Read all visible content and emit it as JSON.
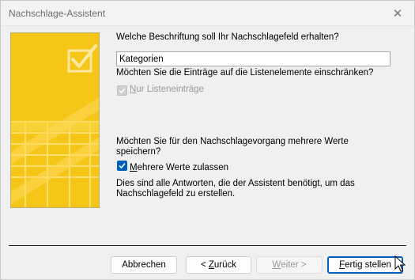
{
  "window": {
    "title": "Nachschlage-Assistent",
    "close_glyph": "✕"
  },
  "question": {
    "caption_prompt": "Welche Beschriftung soll Ihr Nachschlagefeld erhalten?",
    "caption_value": "Kategorien",
    "limit_prompt": "Möchten Sie die Einträge auf die Listenelemente einschränken?",
    "limit_checkbox": {
      "accel": "N",
      "rest": "ur Listeneinträge",
      "checked": true,
      "enabled": false
    },
    "multi_prompt_line1": "Möchten Sie für den Nachschlagevorgang mehrere Werte",
    "multi_prompt_line2": "speichern?",
    "multi_checkbox": {
      "accel": "M",
      "rest": "ehrere Werte zulassen",
      "checked": true,
      "enabled": true
    },
    "info_line1": "Dies sind alle Antworten, die der Assistent benötigt, um das",
    "info_line2": "Nachschlagefeld zu erstellen."
  },
  "buttons": {
    "cancel": "Abbrechen",
    "back_prefix": "< ",
    "back_accel": "Z",
    "back_rest": "urück",
    "next_accel": "W",
    "next_rest": "eiter >",
    "finish_accel": "F",
    "finish_rest": "ertig stellen"
  },
  "colors": {
    "accent": "#005fb8",
    "banner": "#f5c518"
  },
  "icons": {
    "banner_graphic": "checkbox-table-illustration",
    "check": "checkmark-icon",
    "close": "close-icon",
    "cursor": "mouse-pointer-icon"
  }
}
